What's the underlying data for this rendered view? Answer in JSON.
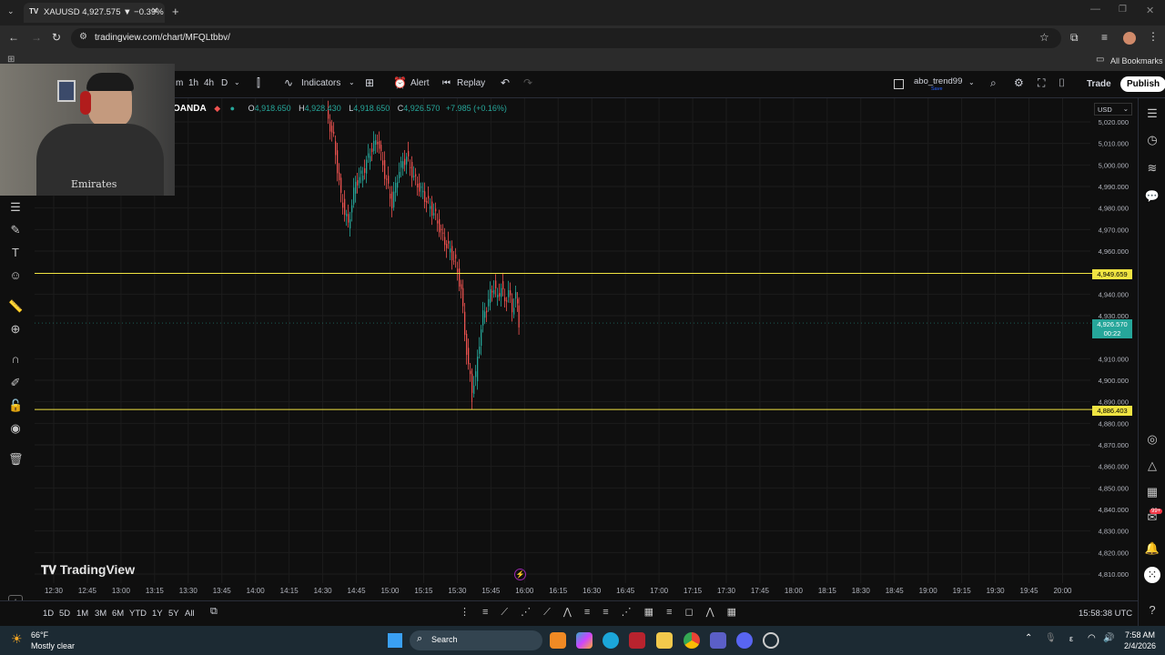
{
  "browser": {
    "tab_title": "XAUUSD 4,927.575 ▼ −0.39% ·",
    "url": "tradingview.com/chart/MFQLtbbv/",
    "bookmarks_label": "All Bookmarks"
  },
  "toolbar": {
    "intervals": [
      "m",
      "1h",
      "4h",
      "D"
    ],
    "indicators_label": "Indicators",
    "alert_label": "Alert",
    "replay_label": "Replay",
    "username": "abo_trend99",
    "save_label": "Save",
    "trade_label": "Trade",
    "publish_label": "Publish"
  },
  "symbol": {
    "broker": "OANDA",
    "open": "4,918.650",
    "high": "4,928.430",
    "low": "4,918.650",
    "close": "4,926.570",
    "change": "+7.985 (+0.16%)",
    "currency": "USD"
  },
  "price_axis": {
    "ticks": [
      "5,020.000",
      "5,010.000",
      "5,000.000",
      "4,990.000",
      "4,980.000",
      "4,970.000",
      "4,960.000",
      "4,940.000",
      "4,930.000",
      "4,910.000",
      "4,900.000",
      "4,890.000",
      "4,880.000",
      "4,870.000",
      "4,860.000",
      "4,850.000",
      "4,840.000",
      "4,830.000",
      "4,820.000",
      "4,810.000"
    ],
    "upper_line_label": "4,949.659",
    "lower_line_label": "4,886.403",
    "current_price_label": "4,926.570",
    "countdown": "00:22"
  },
  "time_axis": {
    "ticks": [
      "12:30",
      "12:45",
      "13:00",
      "13:15",
      "13:30",
      "13:45",
      "14:00",
      "14:15",
      "14:30",
      "14:45",
      "15:00",
      "15:15",
      "15:30",
      "15:45",
      "16:00",
      "16:15",
      "16:30",
      "16:45",
      "17:00",
      "17:15",
      "17:30",
      "17:45",
      "18:00",
      "18:15",
      "18:30",
      "18:45",
      "19:00",
      "19:15",
      "19:30",
      "19:45",
      "20:00"
    ]
  },
  "watermark": "TradingView",
  "bottom": {
    "ranges": [
      "1D",
      "5D",
      "1M",
      "3M",
      "6M",
      "YTD",
      "1Y",
      "5Y",
      "All"
    ],
    "clock": "15:58:38 UTC"
  },
  "badge_count": "99+",
  "taskbar": {
    "weather_temp": "66°F",
    "weather_desc": "Mostly clear",
    "search_label": "Search",
    "time": "7:58 AM",
    "date": "2/4/2026",
    "lang": "ε"
  },
  "webcam_shirt_text": "Emirates",
  "colors": {
    "background": "#0f0f0f",
    "up": "#26a69a",
    "down": "#ef5350",
    "level_line": "#f0e442",
    "current_price": "#26a69a"
  }
}
